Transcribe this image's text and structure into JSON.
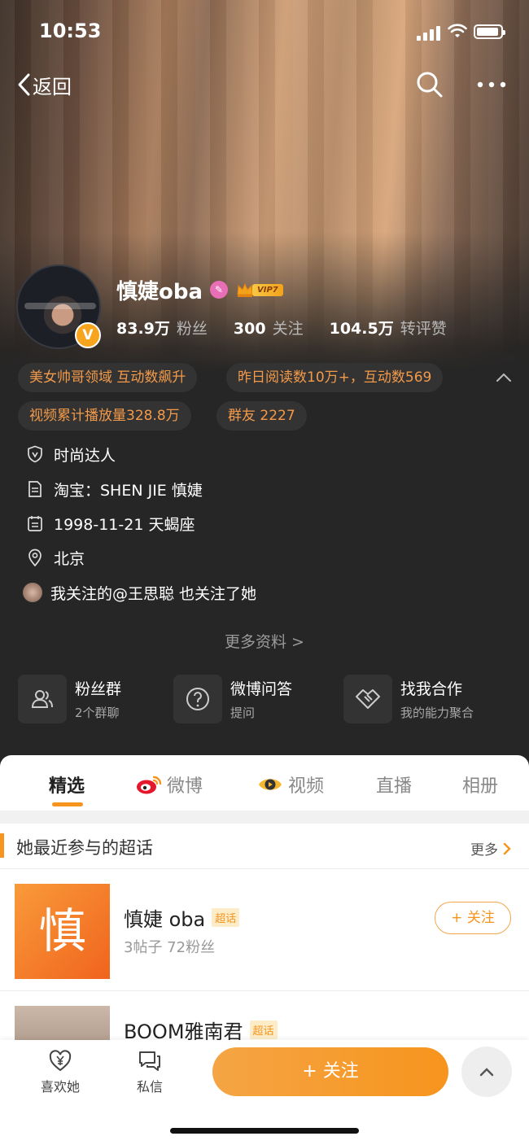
{
  "status": {
    "time": "10:53"
  },
  "nav": {
    "back_label": "返回"
  },
  "profile": {
    "name": "慎婕oba",
    "vip_label": "VIP7",
    "verified_mark": "V",
    "fans_num": "83.9万",
    "fans_label": "粉丝",
    "follow_num": "300",
    "follow_label": "关注",
    "interact_num": "104.5万",
    "interact_label": "转评赞"
  },
  "tags": [
    "美女帅哥领域 互动数飙升",
    "昨日阅读数10万+，互动数569",
    "视频累计播放量328.8万",
    "群友 2227"
  ],
  "info": {
    "title": "时尚达人",
    "taobao": "淘宝：SHEN JIE 慎婕",
    "birthday": "1998-11-21 天蝎座",
    "location": "北京",
    "mutual": "我关注的@王思聪 也关注了她",
    "more": "更多资料 >"
  },
  "features": [
    {
      "title": "粉丝群",
      "sub": "2个群聊"
    },
    {
      "title": "微博问答",
      "sub": "提问"
    },
    {
      "title": "找我合作",
      "sub": "我的能力聚合"
    }
  ],
  "tabs": [
    "精选",
    "微博",
    "视频",
    "直播",
    "相册"
  ],
  "section": {
    "title": "她最近参与的超话",
    "more": "更多"
  },
  "topics": [
    {
      "thumb_char": "慎",
      "name": "慎婕 oba",
      "badge": "超话",
      "sub": "3帖子 72粉丝",
      "follow": "+ 关注"
    },
    {
      "name": "BOOM雅南君",
      "badge": "超话"
    }
  ],
  "bottom": {
    "like": "喜欢她",
    "message": "私信",
    "follow": "+ 关注"
  },
  "colors": {
    "accent": "#f7941d",
    "tag_text": "#f39a4a",
    "dark_bg": "#262626"
  }
}
